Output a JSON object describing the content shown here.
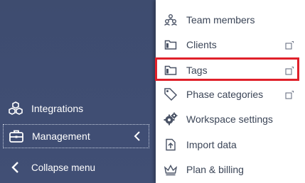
{
  "sidebar": {
    "items": [
      {
        "label": "Integrations",
        "icon": "cubes-icon"
      },
      {
        "label": "Management",
        "icon": "briefcase-icon"
      },
      {
        "label": "Collapse menu",
        "icon": "chevron-left-icon"
      }
    ]
  },
  "menu": {
    "items": [
      {
        "label": "Team members",
        "icon": "team-icon"
      },
      {
        "label": "Clients",
        "icon": "folder-icon"
      },
      {
        "label": "Tags",
        "icon": "folder-icon"
      },
      {
        "label": "Phase categories",
        "icon": "tag-icon"
      },
      {
        "label": "Workspace settings",
        "icon": "gears-icon"
      },
      {
        "label": "Import data",
        "icon": "import-icon"
      },
      {
        "label": "Plan & billing",
        "icon": "crown-icon"
      }
    ]
  },
  "colors": {
    "sidebar_bg": "#3f4d72",
    "highlight": "#e0202a",
    "menu_text": "#3b4557"
  }
}
